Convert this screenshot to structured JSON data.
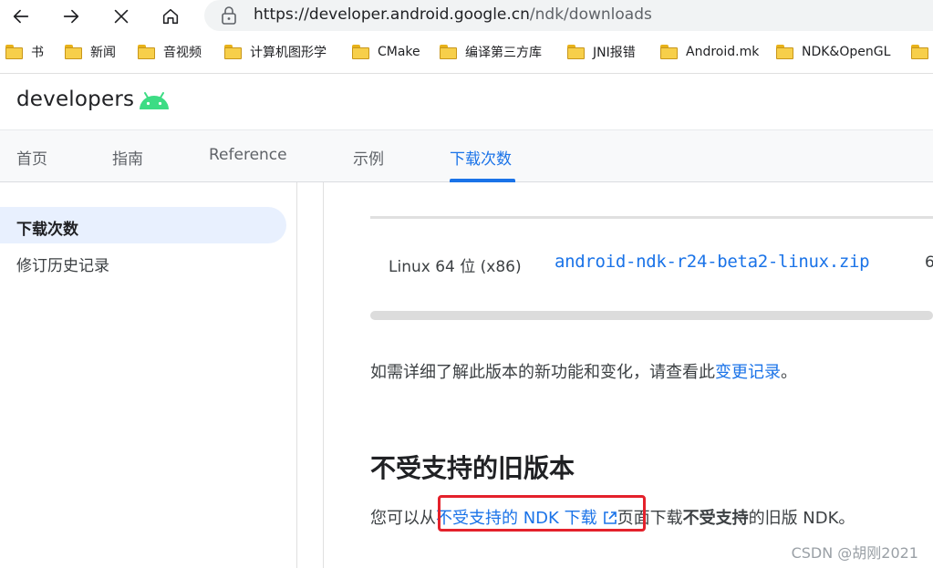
{
  "browser": {
    "url_host": "https://developer.android.google.cn",
    "url_path": "/ndk/downloads",
    "bookmarks": [
      "书",
      "新闻",
      "音视频",
      "计算机图形学",
      "CMake",
      "编译第三方库",
      "JNI报错",
      "Android.mk",
      "NDK&OpenGL"
    ]
  },
  "site": {
    "logo_text": "developers",
    "tabs": [
      "首页",
      "指南",
      "Reference",
      "示例",
      "下载次数"
    ],
    "active_tab": "下载次数"
  },
  "sidebar": {
    "items": [
      {
        "label": "下载次数",
        "active": true
      },
      {
        "label": "修订历史记录",
        "active": false
      }
    ]
  },
  "table": {
    "platform": "Linux 64 位 (x86)",
    "package": "android-ndk-r24-beta2-linux.zip",
    "truncated_next_cell": "6"
  },
  "content": {
    "para1_text": "如需详细了解此版本的新功能和变化，请查看此",
    "para1_link": "变更记录",
    "para1_end": "。",
    "heading": "不受支持的旧版本",
    "para2_pre": "您可以从",
    "para2_link": "不受支持的 NDK 下载",
    "para2_mid": "页面下载",
    "para2_bold": "不受支持",
    "para2_end": "的旧版 NDK。"
  },
  "watermark": "CSDN @胡刚2021",
  "colors": {
    "accent": "#1a73e8",
    "android_green": "#3ddc84",
    "highlight_red": "#e4212b"
  },
  "icons": [
    "back-arrow-icon",
    "forward-arrow-icon",
    "close-icon",
    "home-icon",
    "lock-icon",
    "folder-icon",
    "android-robot-icon",
    "external-link-icon"
  ]
}
